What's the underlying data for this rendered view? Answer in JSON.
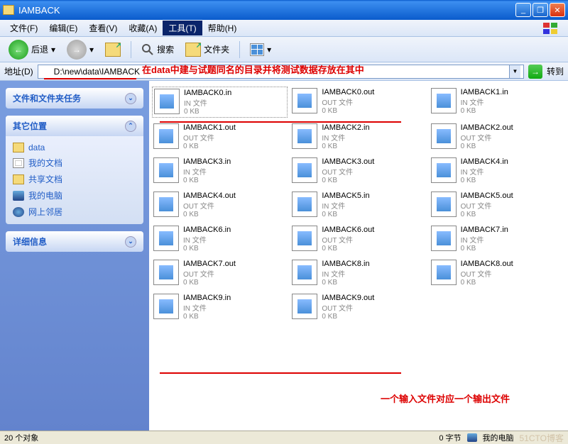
{
  "window": {
    "title": "IAMBACK"
  },
  "menu": {
    "file": "文件(F)",
    "edit": "编辑(E)",
    "view": "查看(V)",
    "favorites": "收藏(A)",
    "tools": "工具(T)",
    "help": "帮助(H)"
  },
  "toolbar": {
    "back": "后退",
    "search": "搜索",
    "folders": "文件夹"
  },
  "address": {
    "label": "地址(D)",
    "path": "D:\\new\\data\\IAMBACK",
    "go": "转到"
  },
  "annotations": {
    "top": "在data中建与试题同名的目录并将测试数据存放在其中",
    "bottom": "一个输入文件对应一个输出文件"
  },
  "sidebar": {
    "tasks_title": "文件和文件夹任务",
    "other_title": "其它位置",
    "other_items": [
      {
        "label": "data",
        "icon": "folder"
      },
      {
        "label": "我的文档",
        "icon": "docs"
      },
      {
        "label": "共享文档",
        "icon": "share"
      },
      {
        "label": "我的电脑",
        "icon": "pc"
      },
      {
        "label": "网上邻居",
        "icon": "net"
      }
    ],
    "details_title": "详细信息"
  },
  "file_types": {
    "in": "IN 文件",
    "out": "OUT 文件",
    "size": "0 KB"
  },
  "files": [
    {
      "name": "IAMBACK0.in",
      "type": "in"
    },
    {
      "name": "IAMBACK0.out",
      "type": "out"
    },
    {
      "name": "IAMBACK1.in",
      "type": "in"
    },
    {
      "name": "IAMBACK1.out",
      "type": "out"
    },
    {
      "name": "IAMBACK2.in",
      "type": "in"
    },
    {
      "name": "IAMBACK2.out",
      "type": "out"
    },
    {
      "name": "IAMBACK3.in",
      "type": "in"
    },
    {
      "name": "IAMBACK3.out",
      "type": "out"
    },
    {
      "name": "IAMBACK4.in",
      "type": "in"
    },
    {
      "name": "IAMBACK4.out",
      "type": "out"
    },
    {
      "name": "IAMBACK5.in",
      "type": "in"
    },
    {
      "name": "IAMBACK5.out",
      "type": "out"
    },
    {
      "name": "IAMBACK6.in",
      "type": "in"
    },
    {
      "name": "IAMBACK6.out",
      "type": "out"
    },
    {
      "name": "IAMBACK7.in",
      "type": "in"
    },
    {
      "name": "IAMBACK7.out",
      "type": "out"
    },
    {
      "name": "IAMBACK8.in",
      "type": "in"
    },
    {
      "name": "IAMBACK8.out",
      "type": "out"
    },
    {
      "name": "IAMBACK9.in",
      "type": "in"
    },
    {
      "name": "IAMBACK9.out",
      "type": "out"
    }
  ],
  "status": {
    "count": "20 个对象",
    "bytes": "0 字节",
    "location": "我的电脑",
    "watermark": "51CTO博客"
  }
}
